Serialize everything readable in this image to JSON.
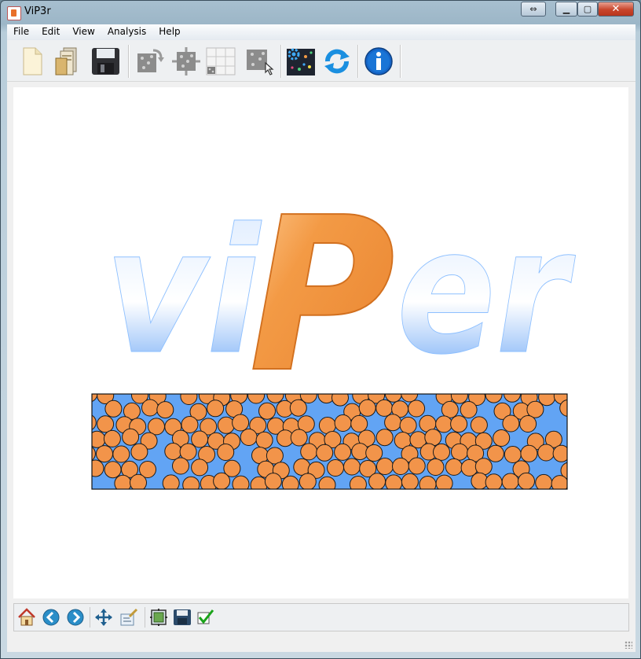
{
  "window": {
    "title": "ViP3r",
    "controls": {
      "resize_glyph": "⇔",
      "minimize_glyph": "▁",
      "maximize_glyph": "▢",
      "close_glyph": "✕"
    }
  },
  "menubar": {
    "items": [
      {
        "label": "File"
      },
      {
        "label": "Edit"
      },
      {
        "label": "View"
      },
      {
        "label": "Analysis"
      },
      {
        "label": "Help"
      }
    ]
  },
  "toolbar": {
    "icons": [
      "new-file-icon",
      "open-folder-icon",
      "save-disk-icon",
      "rotate-image-icon",
      "crop-image-icon",
      "grid-split-icon",
      "select-particle-icon",
      "particle-settings-icon",
      "refresh-icon",
      "info-icon"
    ]
  },
  "splash": {
    "logo_text": "viPer",
    "logo_letters": [
      "vi",
      "P",
      "er"
    ],
    "colors": {
      "blue": "#5a9cf5",
      "orange": "#f39a45",
      "particle_bg": "#62a4f4",
      "particle_fill": "#f2944a"
    }
  },
  "bottom_toolbar": {
    "icons": [
      "home-icon",
      "back-icon",
      "forward-icon",
      "pan-icon",
      "zoom-icon",
      "configure-subplots-icon",
      "save-figure-icon",
      "check-icon"
    ]
  }
}
